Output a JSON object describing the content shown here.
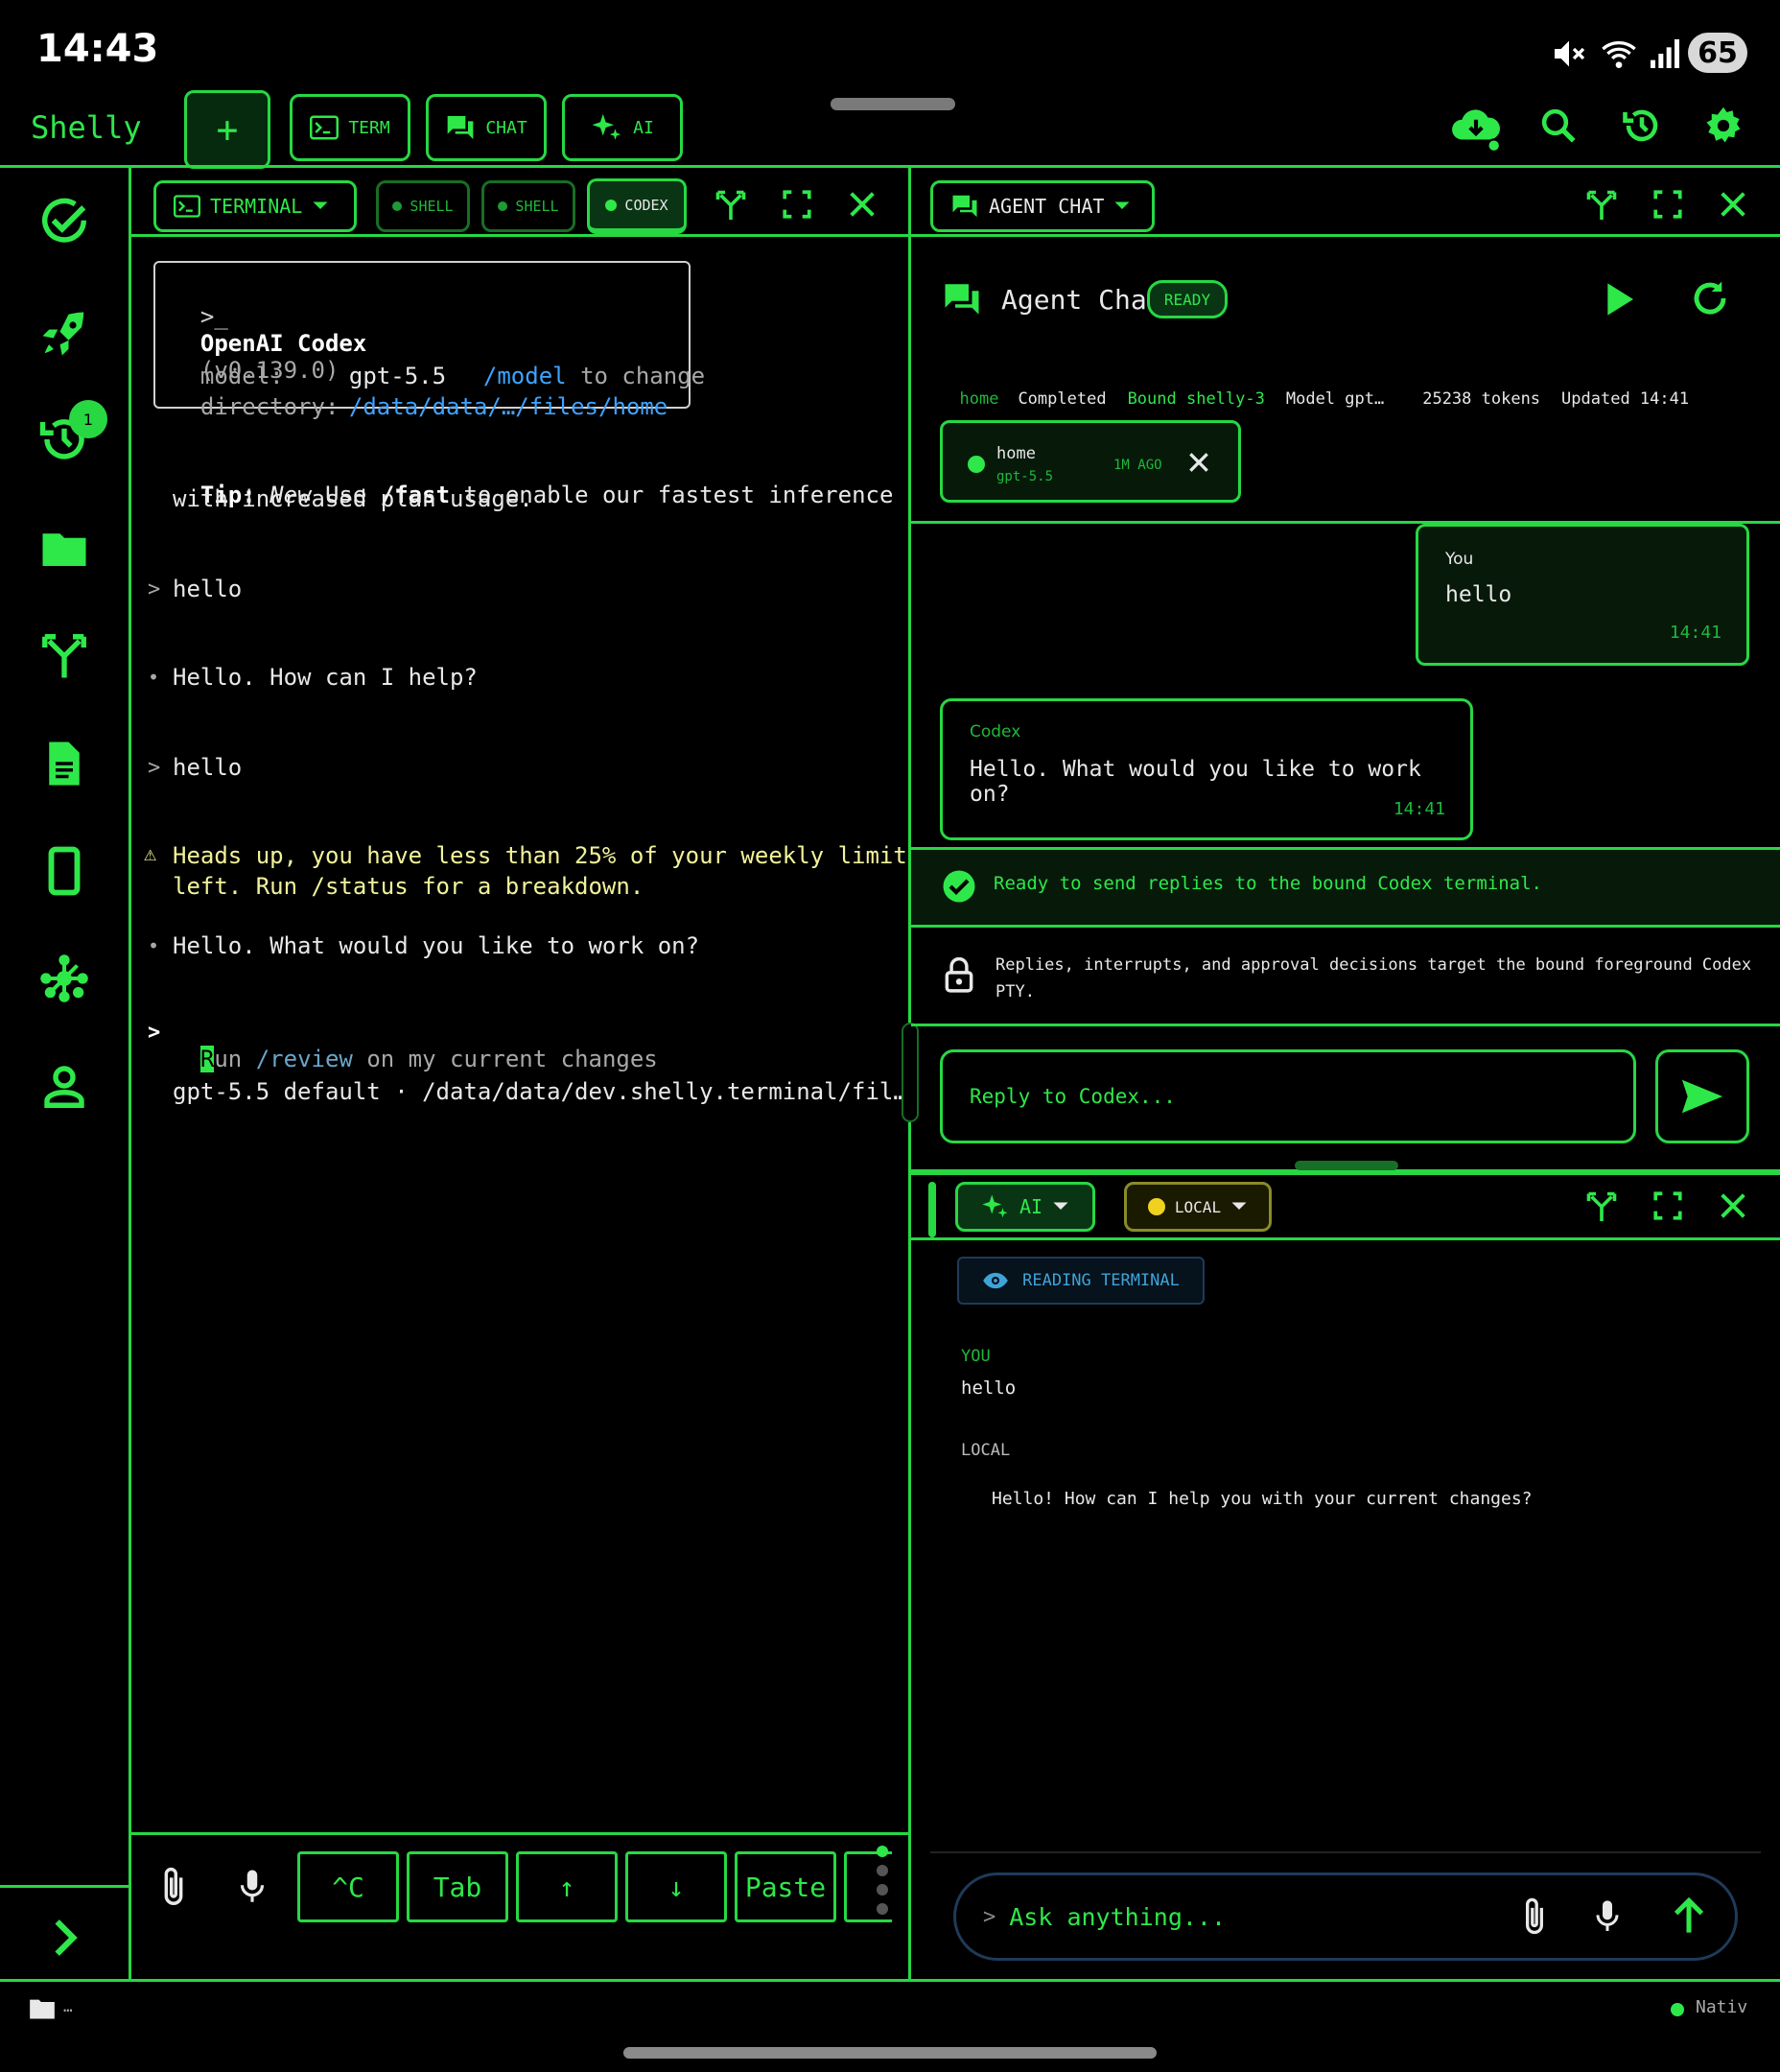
{
  "status_bar": {
    "time": "14:43",
    "battery": "65"
  },
  "app": {
    "title": "Shelly"
  },
  "toolbar": {
    "new_label": "+",
    "term_label": "TERM",
    "chat_label": "CHAT",
    "ai_label": "AI"
  },
  "sidebar": {
    "badge": "1"
  },
  "terminal": {
    "selector_label": "TERMINAL",
    "tabs": [
      "SHELL",
      "SHELL",
      "CODEX"
    ],
    "header_prompt": ">_",
    "header_name": "OpenAI Codex",
    "header_version": "(v0.139.0)",
    "model_key": "model:",
    "model_value": "gpt-5.5",
    "model_cmd": "/model",
    "model_hint": "to change",
    "dir_key": "directory:",
    "dir_value": "/data/data/…/files/home",
    "tip_label": "Tip:",
    "tip_new": "New",
    "tip_use": "Use",
    "tip_cmd": "/fast",
    "tip_rest1": "to enable our fastest inference",
    "tip_rest2": "with increased plan usage.",
    "prompt_marker": ">",
    "bullet_marker": "•",
    "warn_marker": "⚠",
    "lines": {
      "user1": "hello",
      "reply1": "Hello. How can I help?",
      "user2": "hello",
      "warn1": "Heads up, you have less than 25% of your weekly limit",
      "warn2": "left. Run /status for a breakdown.",
      "reply2": "Hello. What would you like to work on?",
      "input_cursor": "R",
      "input_rest_pre": "un ",
      "input_cmd": "/review",
      "input_rest_post": " on my current changes",
      "footer": "gpt-5.5 default · /data/data/dev.shelly.terminal/fil…"
    },
    "keys": [
      "^C",
      "Tab",
      "↑",
      "↓",
      "Paste"
    ]
  },
  "agent_chat": {
    "selector_label": "AGENT CHAT",
    "title": "Agent Chat",
    "ready_badge": "READY",
    "meta": {
      "home": "home",
      "status": "Completed",
      "bound": "Bound shelly-3",
      "model": "Model gpt…",
      "tokens": "25238 tokens",
      "updated": "Updated 14:41"
    },
    "session": {
      "name": "home",
      "model": "gpt-5.5",
      "age": "1M AGO"
    },
    "messages": [
      {
        "sender": "You",
        "text": "hello",
        "time": "14:41"
      },
      {
        "sender": "Codex",
        "text": "Hello. What would you like to work on?",
        "time": "14:41"
      }
    ],
    "ready_text": "Ready to send replies to the bound Codex terminal.",
    "info_text1": "Replies, interrupts, and approval decisions target the bound foreground Codex",
    "info_text2": "PTY.",
    "reply_placeholder": "Reply to Codex..."
  },
  "ai_panel": {
    "selector_label": "AI",
    "mode_label": "LOCAL",
    "reading_badge": "READING TERMINAL",
    "you_label": "YOU",
    "you_text": "hello",
    "local_label": "LOCAL",
    "local_text": "Hello! How can I help you with your current changes?",
    "ask_prompt": ">",
    "ask_placeholder": "Ask anything..."
  },
  "bottom_bar": {
    "left_text": "…",
    "right_text": "Nativ"
  }
}
